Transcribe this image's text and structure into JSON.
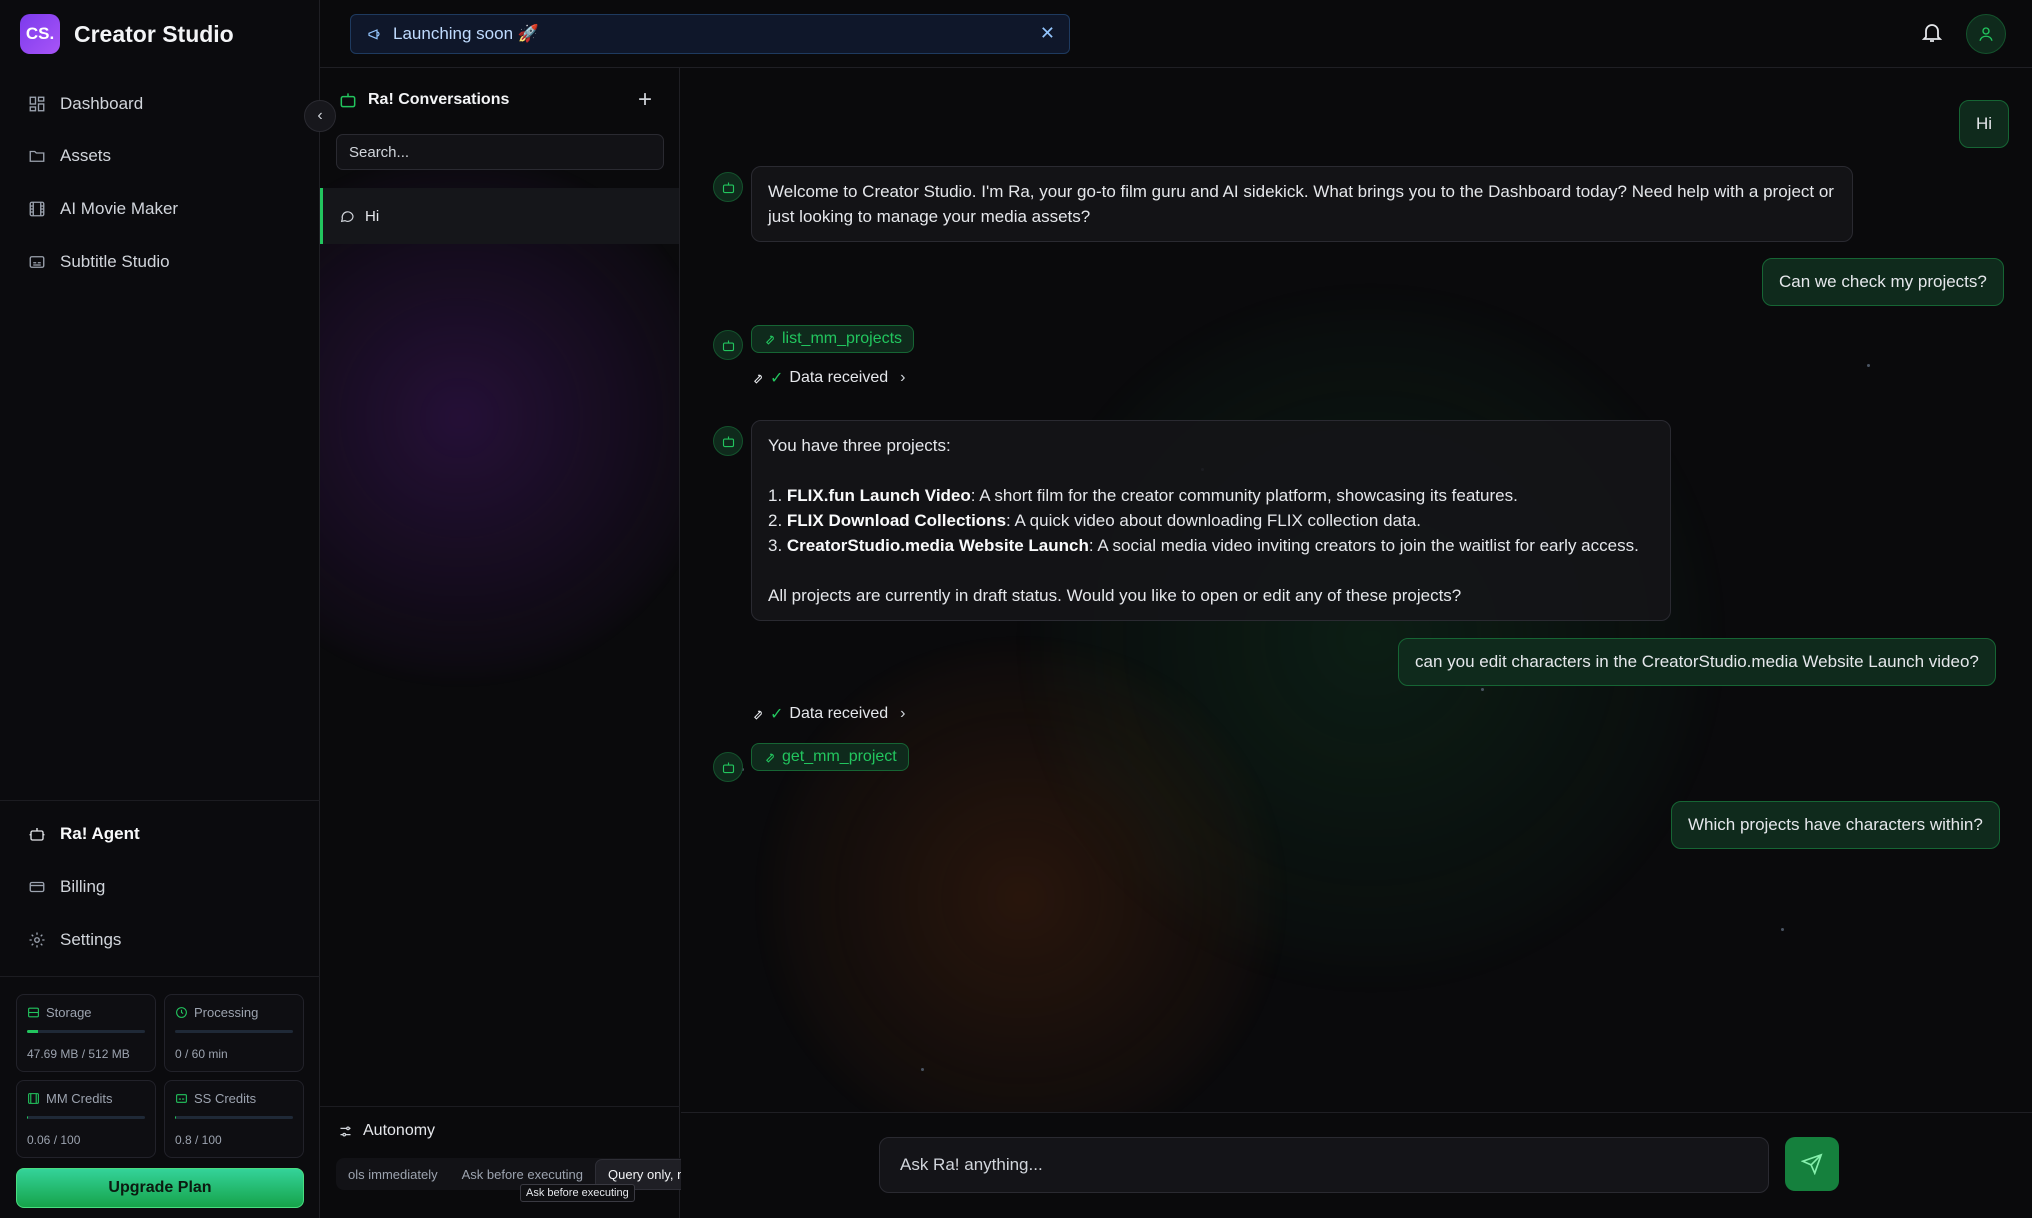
{
  "brand": {
    "logo_text": "CS.",
    "name": "Creator Studio"
  },
  "nav_top": [
    {
      "label": "Dashboard",
      "icon": "dashboard-icon"
    },
    {
      "label": "Assets",
      "icon": "folder-icon"
    },
    {
      "label": "AI Movie Maker",
      "icon": "film-icon"
    },
    {
      "label": "Subtitle Studio",
      "icon": "subtitles-icon"
    }
  ],
  "nav_bottom": [
    {
      "label": "Ra! Agent",
      "icon": "bot-icon"
    },
    {
      "label": "Billing",
      "icon": "credit-card-icon"
    },
    {
      "label": "Settings",
      "icon": "gear-icon"
    }
  ],
  "stats": [
    {
      "label": "Storage",
      "value": "47.69 MB / 512 MB",
      "fill": 0.093
    },
    {
      "label": "Processing",
      "value": "0 / 60 min",
      "fill": 0.0
    },
    {
      "label": "MM Credits",
      "value": "0.06 / 100",
      "fill": 0.0006
    },
    {
      "label": "SS Credits",
      "value": "0.8 / 100",
      "fill": 0.008
    }
  ],
  "upgrade_label": "Upgrade Plan",
  "banner": {
    "text": "Launching soon 🚀"
  },
  "conversations": {
    "title": "Ra! Conversations",
    "add_label": "+",
    "search_placeholder": "Search...",
    "items": [
      {
        "label": "Hi"
      }
    ],
    "collapse_label": "‹"
  },
  "autonomy": {
    "title": "Autonomy",
    "options": [
      "Run tools immediately",
      "Ask before executing",
      "Query only, no actions"
    ],
    "visible_options": [
      "ols immediately",
      "Ask before executing",
      "Query only, no actions"
    ],
    "selected": "Query only, no actions",
    "tooltip": "Ask before executing"
  },
  "chat": {
    "user_1": "Hi",
    "bot_1": "Welcome to Creator Studio. I'm Ra, your go-to film guru and AI sidekick. What brings you to the Dashboard today? Need help with a project or just looking to manage your media assets?",
    "user_2": "Can we check my projects?",
    "tool_1": "list_mm_projects",
    "data_received": "Data received",
    "bot_2_intro": "You have three projects:",
    "projects": [
      {
        "name": "FLIX.fun Launch Video",
        "desc": ": A short film for the creator community platform, showcasing its features."
      },
      {
        "name": "FLIX Download Collections",
        "desc": ": A quick video about downloading FLIX collection data."
      },
      {
        "name": "CreatorStudio.media Website Launch",
        "desc": ": A social media video inviting creators to join the waitlist for early access."
      }
    ],
    "bot_2_outro": "All projects are currently in draft status. Would you like to open or edit any of these projects?",
    "user_3": "can you edit characters in the CreatorStudio.media Website Launch video?",
    "tool_2": "get_mm_project",
    "user_4": "Which projects have characters within?"
  },
  "composer": {
    "placeholder": "Ask Ra! anything..."
  },
  "colors": {
    "accent": "#22c55e",
    "brand": "#7c3aed",
    "banner": "#0f172a"
  }
}
